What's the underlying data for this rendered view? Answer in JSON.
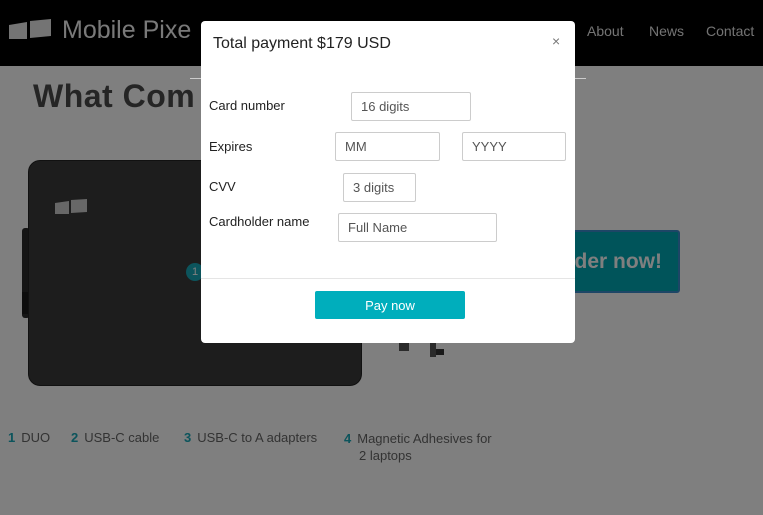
{
  "header": {
    "brand": "Mobile Pixe",
    "logo": "mobile-pixels-logo",
    "nav": [
      "About",
      "News",
      "Contact"
    ]
  },
  "page": {
    "heading": "What Com",
    "callout": "1",
    "order_button": "rder now!",
    "items": [
      {
        "num": "1",
        "label": "DUO"
      },
      {
        "num": "2",
        "label": "USB-C cable"
      },
      {
        "num": "3",
        "label": "USB-C to A adapters"
      },
      {
        "num": "4",
        "label": "Magnetic Adhesives for",
        "label2": "2 laptops"
      }
    ]
  },
  "modal": {
    "title": "Total payment $179 USD",
    "close": "×",
    "fields": {
      "card_number": {
        "label": "Card number",
        "placeholder": "16 digits"
      },
      "expires": {
        "label": "Expires",
        "month_placeholder": "MM",
        "year_placeholder": "YYYY"
      },
      "cvv": {
        "label": "CVV",
        "placeholder": "3 digits"
      },
      "cardholder": {
        "label": "Cardholder name",
        "placeholder": "Full Name"
      }
    },
    "pay_button": "Pay now"
  },
  "colors": {
    "accent": "#00aebc",
    "navbar": "#000000",
    "overlay": "rgba(0,0,0,0.5)"
  }
}
